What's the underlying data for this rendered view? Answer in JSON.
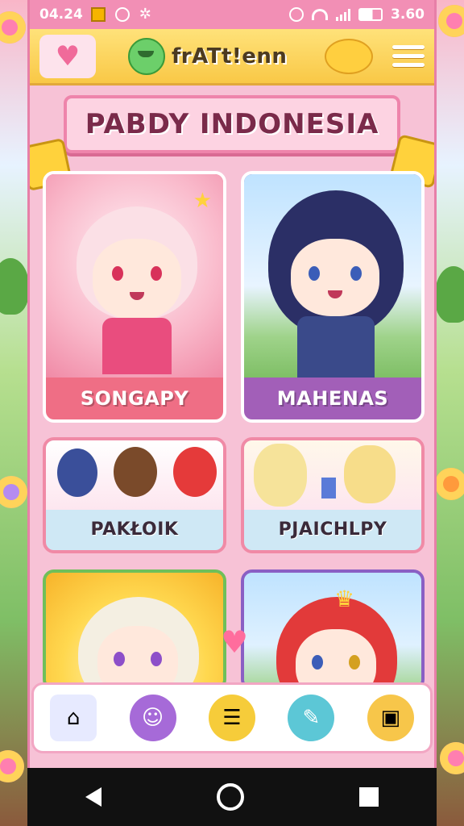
{
  "status_bar": {
    "time": "04.24",
    "battery": "3.60",
    "icons": [
      "notification-square-icon",
      "alarm-icon",
      "settings-gear-icon",
      "clock-icon",
      "wifi-icon",
      "signal-icon",
      "battery-icon"
    ]
  },
  "header": {
    "logo_text": "frATt!enn",
    "left_icon": "heart-icon",
    "right_icon": "hamburger-menu-icon"
  },
  "banner": {
    "title": "PABDY INDONESIA"
  },
  "cards": [
    {
      "label": "SONGAPY",
      "color": "#ef6e85"
    },
    {
      "label": "MAHENAS",
      "color": "#a25fb8"
    },
    {
      "label": "PAKŁOIK",
      "color": "#cfe8f5"
    },
    {
      "label": "PJAICHLPY",
      "color": "#cfe8f5"
    },
    {
      "label": "",
      "color": "#f7c64a"
    },
    {
      "label": "",
      "color": "#9fd3ee"
    }
  ],
  "bottom_nav": {
    "items": [
      "home-icon",
      "chat-icon",
      "list-icon",
      "edit-icon",
      "album-icon"
    ]
  },
  "colors": {
    "accent_pink": "#f28fb5",
    "header_yellow": "#ffe27a",
    "title_text": "#7a2a4a"
  }
}
